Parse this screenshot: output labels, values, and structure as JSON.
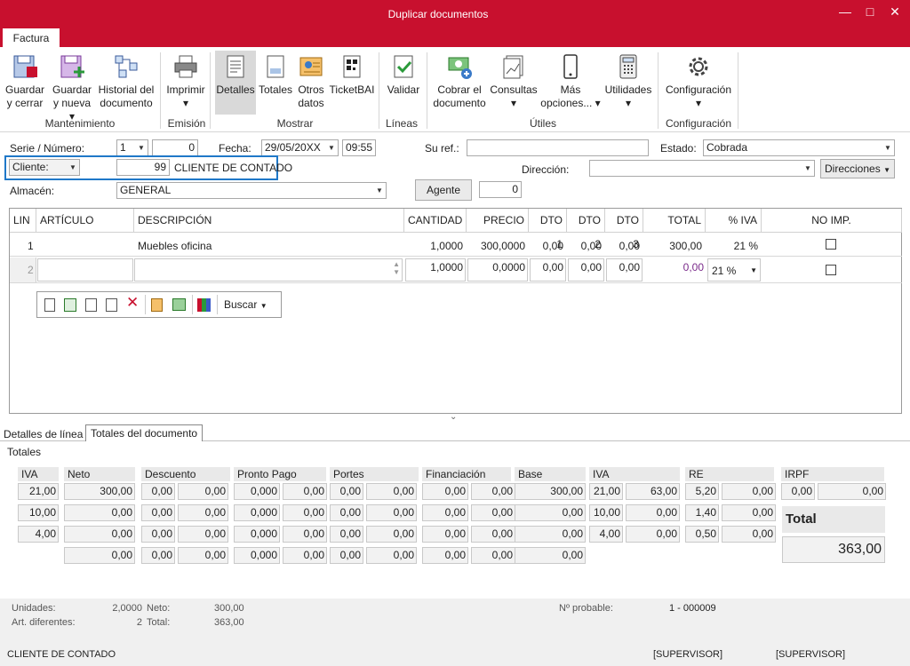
{
  "window": {
    "title": "Duplicar documentos",
    "minimize": "—",
    "maximize": "□",
    "close": "✕"
  },
  "ribbon": {
    "tab": "Factura",
    "buttons": {
      "guardar_cerrar": [
        "Guardar",
        "y cerrar"
      ],
      "guardar_nueva": [
        "Guardar",
        "y nueva ▾"
      ],
      "historial": [
        "Historial del",
        "documento"
      ],
      "imprimir": [
        "Imprimir",
        "▾"
      ],
      "detalles": "Detalles",
      "totales": "Totales",
      "otros": [
        "Otros",
        "datos"
      ],
      "ticketbai": "TicketBAI",
      "validar": "Validar",
      "cobrar": [
        "Cobrar el",
        "documento"
      ],
      "consultas": [
        "Consultas",
        "▾"
      ],
      "mas": [
        "Más",
        "opciones... ▾"
      ],
      "utilidades": [
        "Utilidades",
        "▾"
      ],
      "configuracion": [
        "Configuración",
        "▾"
      ]
    },
    "groups": {
      "mantenimiento": "Mantenimiento",
      "emision": "Emisión",
      "mostrar": "Mostrar",
      "lineas": "Líneas",
      "utiles": "Útiles",
      "configuracion": "Configuración"
    }
  },
  "form": {
    "serie_label": "Serie / Número:",
    "serie": "1",
    "numero": "0",
    "fecha_label": "Fecha:",
    "fecha": "29/05/20XX",
    "hora": "09:55",
    "suref_label": "Su ref.:",
    "suref": "",
    "estado_label": "Estado:",
    "estado": "Cobrada",
    "cliente_label": "Cliente:",
    "cliente_code": "99",
    "cliente_name": "CLIENTE DE CONTADO",
    "direccion_label": "Dirección:",
    "direcciones_btn": "Direcciones",
    "almacen_label": "Almacén:",
    "almacen": "GENERAL",
    "agente_btn": "Agente",
    "agente": "0"
  },
  "grid": {
    "headers": [
      "LIN",
      "ARTÍCULO",
      "DESCRIPCIÓN",
      "CANTIDAD",
      "PRECIO",
      "DTO 1",
      "DTO 2",
      "DTO 3",
      "TOTAL",
      "% IVA",
      "NO IMP."
    ],
    "rows": [
      {
        "lin": "1",
        "articulo": "",
        "descripcion": "Muebles oficina",
        "cantidad": "1,0000",
        "precio": "300,0000",
        "dto1": "0,00",
        "dto2": "0,00",
        "dto3": "0,00",
        "total": "300,00",
        "iva": "21 %"
      },
      {
        "lin": "2",
        "articulo": "",
        "descripcion": "",
        "cantidad": "1,0000",
        "precio": "0,0000",
        "dto1": "0,00",
        "dto2": "0,00",
        "dto3": "0,00",
        "total": "0,00",
        "iva": "21 %"
      }
    ],
    "toolbar_search": "Buscar"
  },
  "bottom_tabs": [
    "Detalles de línea",
    "Totales del documento"
  ],
  "totals": {
    "title": "Totales",
    "headers": [
      "IVA",
      "Neto",
      "Descuento",
      "Pronto Pago",
      "Portes",
      "Financiación",
      "Base",
      "IVA",
      "RE",
      "IRPF"
    ],
    "rows": [
      [
        "21,00",
        "300,00",
        "0,00",
        "0,00",
        "0,000",
        "0,00",
        "0,00",
        "0,00",
        "0,00",
        "0,00",
        "300,00",
        "21,00",
        "63,00",
        "5,20",
        "0,00",
        "0,00",
        "0,00"
      ],
      [
        "10,00",
        "0,00",
        "0,00",
        "0,00",
        "0,000",
        "0,00",
        "0,00",
        "0,00",
        "0,00",
        "0,00",
        "0,00",
        "10,00",
        "0,00",
        "1,40",
        "0,00"
      ],
      [
        "4,00",
        "0,00",
        "0,00",
        "0,00",
        "0,000",
        "0,00",
        "0,00",
        "0,00",
        "0,00",
        "0,00",
        "0,00",
        "4,00",
        "0,00",
        "0,50",
        "0,00"
      ],
      [
        "",
        "0,00",
        "0,00",
        "0,00",
        "0,000",
        "0,00",
        "0,00",
        "0,00",
        "0,00",
        "0,00",
        "0,00"
      ]
    ],
    "total_label": "Total",
    "total_value": "363,00"
  },
  "status": {
    "unidades_label": "Unidades:",
    "unidades": "2,0000",
    "art_label": "Art. diferentes:",
    "art": "2",
    "neto_label": "Neto:",
    "neto": "300,00",
    "total_label": "Total:",
    "total": "363,00",
    "nprob_label": "Nº probable:",
    "nprob": "1 - 000009",
    "cliente": "CLIENTE DE CONTADO",
    "user1": "[SUPERVISOR]",
    "user2": "[SUPERVISOR]"
  }
}
